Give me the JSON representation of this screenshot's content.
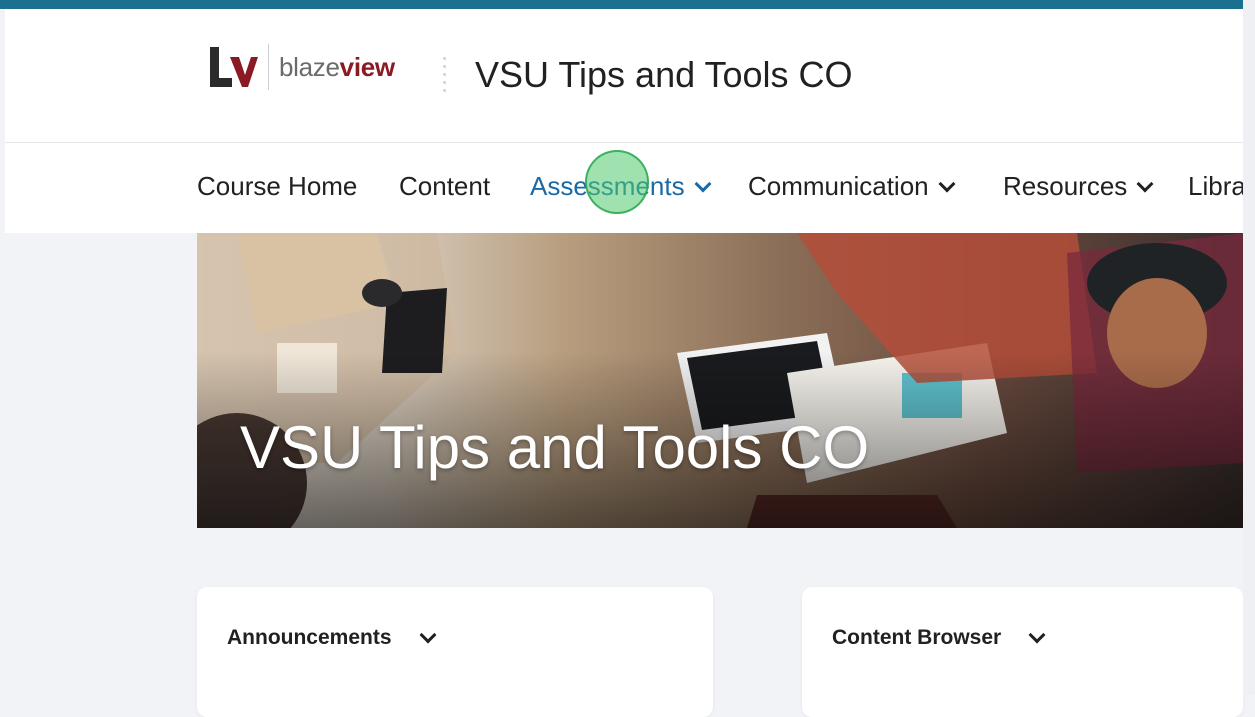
{
  "header": {
    "logo_text_light": "blaze",
    "logo_text_bold": "view",
    "course_title": "VSU Tips and Tools CO"
  },
  "nav": {
    "items": [
      {
        "label": "Course Home"
      },
      {
        "label": "Content"
      },
      {
        "label": "Assessments"
      },
      {
        "label": "Communication"
      },
      {
        "label": "Resources"
      },
      {
        "label": "Libra"
      }
    ]
  },
  "banner": {
    "title": "VSU Tips and Tools CO"
  },
  "cards": {
    "announcements_title": "Announcements",
    "content_browser_title": "Content Browser"
  },
  "colors": {
    "accent_bar": "#1b6f8f",
    "active_nav": "#1a6aa8",
    "logo_brand": "#8a1a23"
  }
}
